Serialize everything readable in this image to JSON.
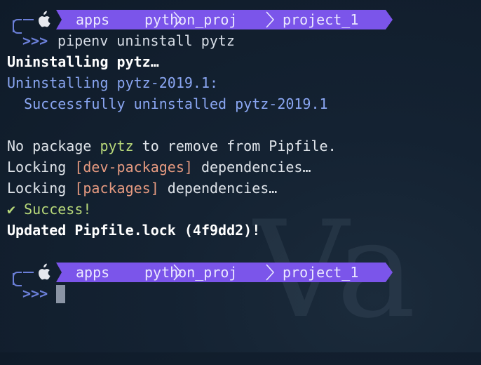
{
  "prompt": {
    "path": [
      "apps",
      "python_proj",
      "project_1"
    ],
    "chevrons": ">>>"
  },
  "command": "pipenv uninstall pytz",
  "output": {
    "line1": "Uninstalling pytz…",
    "line2": "Uninstalling pytz-2019.1:",
    "line3": "  Successfully uninstalled pytz-2019.1",
    "line4_pre": "No package ",
    "line4_pkg": "pytz",
    "line4_post": " to remove from Pipfile.",
    "line5_pre": "Locking ",
    "line5_bracket": "[dev-packages]",
    "line5_post": " dependencies…",
    "line6_pre": "Locking ",
    "line6_bracket": "[packages]",
    "line6_post": " dependencies…",
    "line7_check": "✔",
    "line7_text": " Success!",
    "line8": "Updated Pipfile.lock (4f9dd2)!"
  },
  "colors": {
    "prompt_segment": "#7b55ea",
    "prompt_line": "#6b7fd8",
    "info_blue": "#8aa6f2",
    "success_green": "#b8d97a",
    "bracket_salmon": "#e69a80",
    "background": "#0f1b29"
  },
  "icons": {
    "os": "apple-icon",
    "segment_separator": "chevron-right-icon"
  }
}
